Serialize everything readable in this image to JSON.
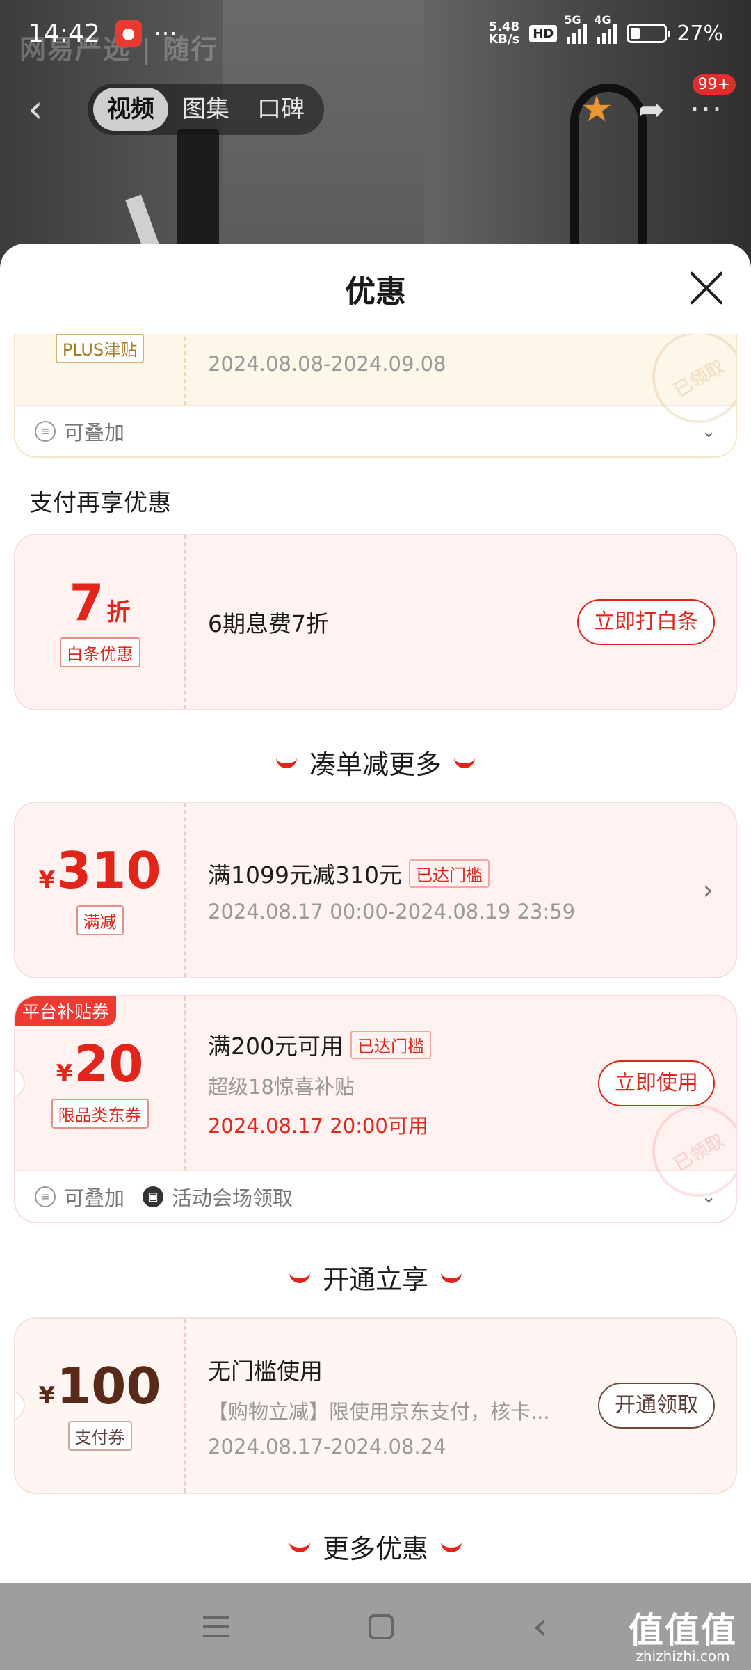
{
  "status_bar": {
    "time": "14:42",
    "dots": "···",
    "speed_top": "5.48",
    "speed_bottom": "KB/s",
    "hd": "HD",
    "net1": "5G",
    "net2": "4G",
    "battery_level": 0.27,
    "battery_pct": "27%"
  },
  "background": {
    "faded_logo": "网易严选 | 随行"
  },
  "nav": {
    "tabs": [
      {
        "label": "视频",
        "active": true
      },
      {
        "label": "图集",
        "active": false
      },
      {
        "label": "口碑",
        "active": false
      }
    ],
    "cart_badge": "99+"
  },
  "sheet": {
    "title": "优惠",
    "plus_card": {
      "tag": "PLUS津贴",
      "date": "2024.08.08-2024.09.08",
      "stamp": "已领取",
      "foot": "可叠加"
    },
    "pay_section_title": "支付再享优惠",
    "baitiao_card": {
      "amount": "7",
      "unit": "折",
      "tag": "白条优惠",
      "desc": "6期息费7折",
      "button": "立即打白条"
    },
    "more_section_title": "凑单减更多",
    "manjian_card": {
      "yen": "¥",
      "amount": "310",
      "tag": "满减",
      "desc": "满1099元减310元",
      "badge": "已达门槛",
      "date": "2024.08.17 00:00-2024.08.19 23:59"
    },
    "subsidy_card": {
      "ribbon": "平台补贴券",
      "yen": "¥",
      "amount": "20",
      "tag": "限品类东券",
      "desc": "满200元可用",
      "badge": "已达门槛",
      "sub": "超级18惊喜补贴",
      "available": "2024.08.17 20:00可用",
      "button": "立即使用",
      "stamp": "已领取",
      "foot1": "可叠加",
      "foot2": "活动会场领取"
    },
    "open_section_title": "开通立享",
    "pay_coupon_card": {
      "yen": "¥",
      "amount": "100",
      "tag": "支付券",
      "desc": "无门槛使用",
      "sub": "【购物立减】限使用京东支付，核卡...",
      "date": "2024.08.17-2024.08.24",
      "button": "开通领取"
    },
    "more_offers_title": "更多优惠"
  },
  "watermark": {
    "big": "值值值",
    "small": "zhizhizhi.com"
  },
  "colors": {
    "accent": "#e1251b",
    "plus_gold": "#a77a23"
  }
}
